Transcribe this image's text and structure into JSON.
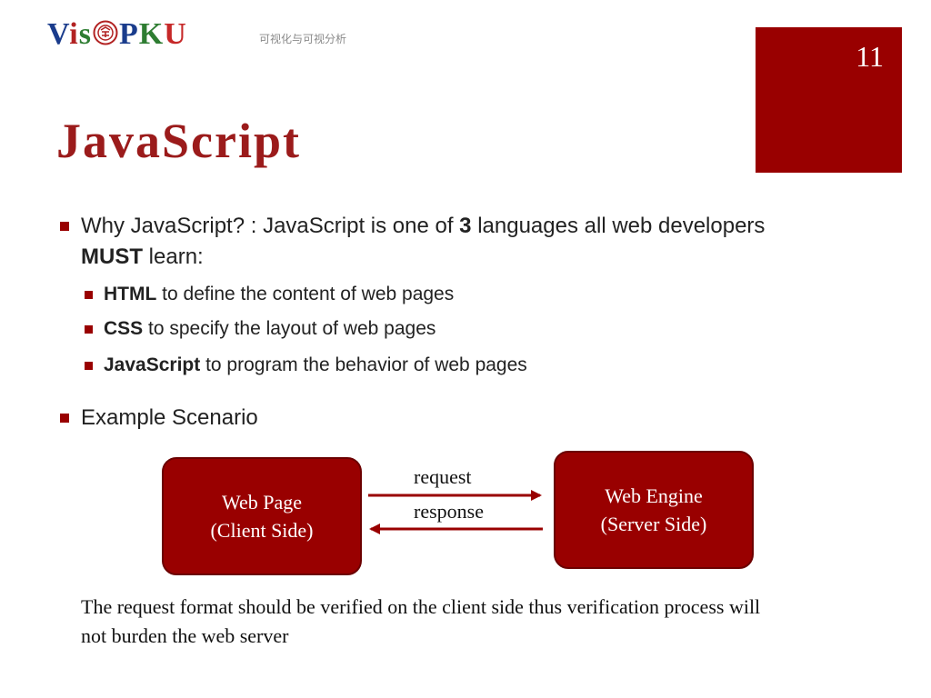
{
  "header": {
    "logo_letters": [
      "V",
      "i",
      "s",
      "P",
      "K",
      "U"
    ],
    "logo_colors": [
      "#1a3c8c",
      "#b22222",
      "#2e7d32",
      "#b22222",
      "#1a3c8c",
      "#2e7d32",
      "#c62828"
    ],
    "subtitle": "可视化与可视分析",
    "slide_number": "11"
  },
  "title": "JavaScript",
  "bullets": {
    "main": {
      "pre": "Why JavaScript? : JavaScript is one of ",
      "bold1": "3",
      "mid": " languages all web developers ",
      "bold2": "MUST",
      "post": " learn:"
    },
    "sub": [
      {
        "bold": "HTML",
        "text": " to define the content of web pages"
      },
      {
        "bold": "CSS",
        "text": " to specify the layout of web pages"
      },
      {
        "bold": "JavaScript",
        "text": " to program the behavior of web pages"
      }
    ],
    "example": "Example Scenario"
  },
  "diagram": {
    "client_line1": "Web Page",
    "client_line2": "(Client Side)",
    "server_line1": "Web Engine",
    "server_line2": "(Server Side)",
    "request_label": "request",
    "response_label": "response",
    "accent": "#990000"
  },
  "note": "The request format should be verified on the client side thus verification process will not burden the web server"
}
